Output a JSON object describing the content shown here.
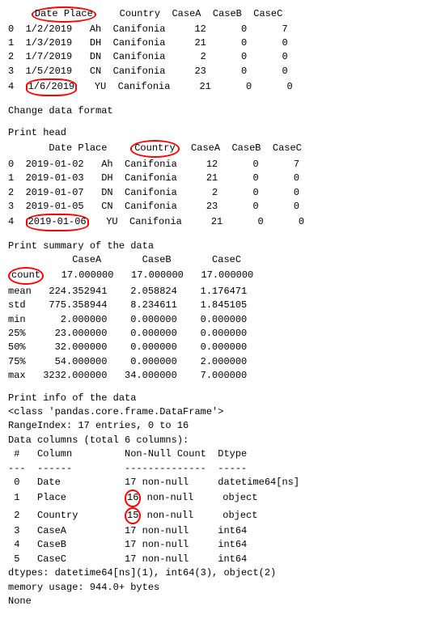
{
  "sections": {
    "table1": {
      "header": "    Date Place    Country  CaseA  CaseB  CaseC",
      "rows": [
        "0  1/2/2019   Ah  Canifonia     12      0      7",
        "1  1/3/2019   DH  Canifonia     21      0      0",
        "2  1/7/2019   DN  Canifonia      2      0      0",
        "3  1/5/2019   CN  Canifonia     23      0      0",
        "4  1/6/2019   YU  Canifonia     21      0      0"
      ]
    },
    "label_change": "Change data format",
    "label_head": "Print head",
    "table2": {
      "header": "       Date Place    Country  CaseA  CaseB  CaseC",
      "rows": [
        "0  2019-01-02   Ah  Canifonia     12      0      7",
        "1  2019-01-03   DH  Canifonia     21      0      0",
        "2  2019-01-07   DN  Canifonia      2      0      0",
        "3  2019-01-05   CN  Canifonia     23      0      0",
        "4  2019-01-06   YU  Canifonia     21      0      0"
      ]
    },
    "label_summary": "Print summary of the data",
    "summary": {
      "header": "           CaseA       CaseB       CaseC",
      "rows": [
        "count   17.000000   17.000000   17.000000",
        "mean   224.352941    2.058824    1.176471",
        "std    775.358944    8.234611    1.845105",
        "min      2.000000    0.000000    0.000000",
        "25%     23.000000    0.000000    0.000000",
        "50%     32.000000    0.000000    0.000000",
        "75%     54.000000    0.000000    2.000000",
        "max   3232.000000   34.000000    7.000000"
      ]
    },
    "label_info": "Print info of the data",
    "info": {
      "lines": [
        "<class 'pandas.core.frame.DataFrame'>",
        "RangeIndex: 17 entries, 0 to 16",
        "Data columns (total 6 columns):",
        " #   Column         Non-Null Count  Dtype",
        "---  ------         --------------  -----",
        " 0   Date           17 non-null     datetime64[ns]",
        " 1   Place          16 non-null     object",
        " 2   Country        15 non-null     object",
        " 3   CaseA          17 non-null     int64",
        " 4   CaseB          17 non-null     int64",
        " 5   CaseC          17 non-null     int64",
        "dtypes: datetime64[ns](1), int64(3), object(2)",
        "memory usage: 944.0+ bytes",
        "None"
      ]
    }
  }
}
